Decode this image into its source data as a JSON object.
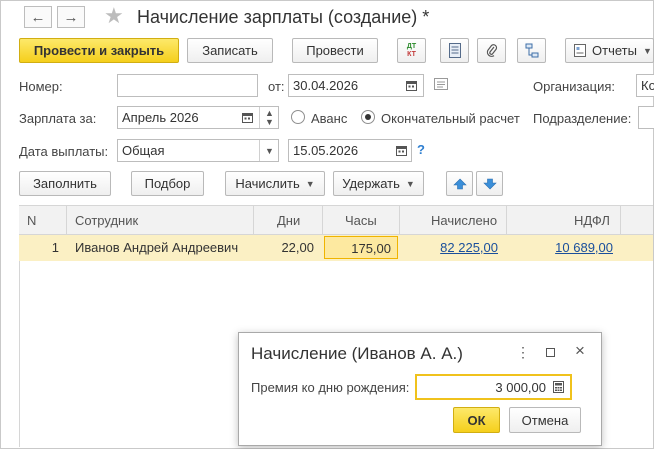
{
  "window": {
    "title": "Начисление зарплаты (создание) *",
    "back_icon": "←",
    "forward_icon": "→",
    "star_icon": "★"
  },
  "toolbar": {
    "post_close_label": "Провести и закрыть",
    "save_label": "Записать",
    "post_label": "Провести",
    "dt_label": "ДТ",
    "kt_label": "КТ",
    "reports_label": "Отчеты"
  },
  "form": {
    "number_label": "Номер:",
    "number_value": "",
    "date_from_label": "от:",
    "date_value": "30.04.2026",
    "organization_label": "Организация:",
    "organization_value": "Ко",
    "salary_for_label": "Зарплата за:",
    "month_value": "Апрель 2026",
    "advance_label": "Аванс",
    "final_calc_label": "Окончательный расчет",
    "department_label": "Подразделение:",
    "payment_date_label": "Дата выплаты:",
    "payment_type_value": "Общая",
    "payment_date_value": "15.05.2026",
    "help_label": "?"
  },
  "actions": {
    "fill_label": "Заполнить",
    "select_label": "Подбор",
    "accrue_label": "Начислить",
    "withhold_label": "Удержать"
  },
  "table": {
    "headers": {
      "n": "N",
      "employee": "Сотрудник",
      "days": "Дни",
      "hours": "Часы",
      "accrued": "Начислено",
      "ndfl": "НДФЛ"
    },
    "rows": [
      {
        "n": "1",
        "employee": "Иванов Андрей Андреевич",
        "days": "22,00",
        "hours": "175,00",
        "accrued": "82 225,00",
        "ndfl": "10 689,00"
      }
    ]
  },
  "dialog": {
    "title": "Начисление (Иванов А. А.)",
    "field_label": "Премия ко дню рождения:",
    "field_value": "3 000,00",
    "ok_label": "ОК",
    "cancel_label": "Отмена"
  },
  "colors": {
    "primary_button": "#f5cf1c",
    "row_highlight": "#fbf0c4",
    "link": "#1a4f9c",
    "arrow_button": "#3b8fd9"
  }
}
